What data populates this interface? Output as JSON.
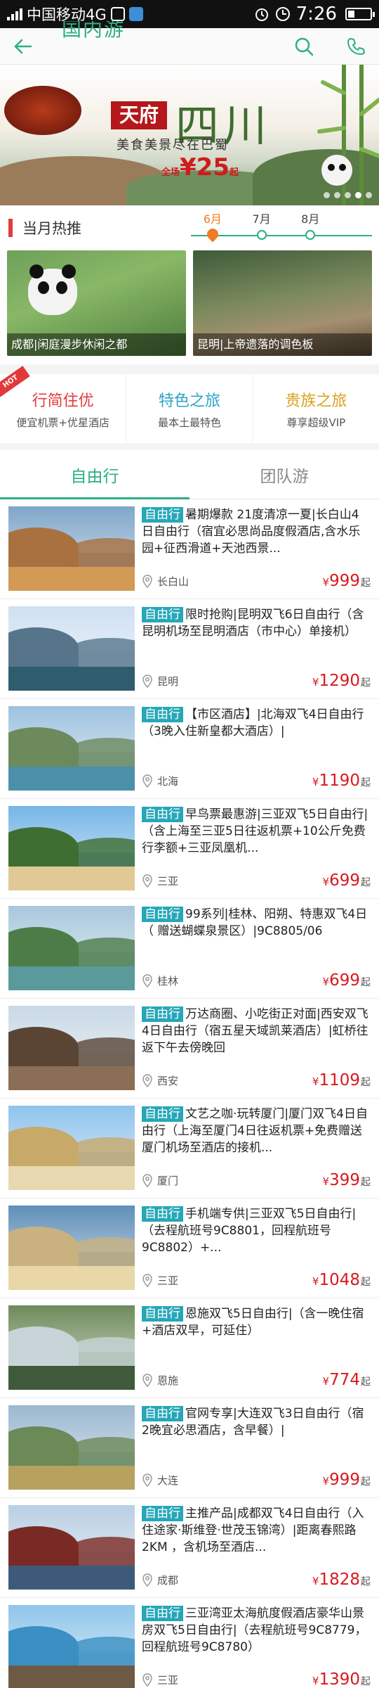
{
  "status_bar": {
    "carrier": "中国移动4G",
    "time": "7:26",
    "battery_level": 0.3
  },
  "header": {
    "title": "国内游",
    "back_icon": "arrow-left-icon",
    "search_icon": "search-icon",
    "phone_icon": "phone-icon"
  },
  "banner": {
    "tag": "天府",
    "title": "四川",
    "slogan": "美食美景尽在巴蜀",
    "price_prefix": "全场",
    "price": "¥25",
    "price_suffix": "起",
    "slide_count": 5,
    "active_slide": 3
  },
  "hot": {
    "label": "当月热推",
    "months": [
      {
        "label": "6月",
        "active": true
      },
      {
        "label": "7月",
        "active": false
      },
      {
        "label": "8月",
        "active": false
      }
    ],
    "cards": [
      {
        "caption": "成都|闲庭漫步休闲之都"
      },
      {
        "caption": "昆明|上帝遗落的调色板"
      }
    ]
  },
  "categories": [
    {
      "title": "行简住优",
      "subtitle": "便宜机票+优星酒店",
      "color": "#e23b3b",
      "hot_ribbon": "HOT"
    },
    {
      "title": "特色之旅",
      "subtitle": "最本土最特色",
      "color": "#2fa3c8"
    },
    {
      "title": "贵族之旅",
      "subtitle": "尊享超级VIP",
      "color": "#d8a21f"
    }
  ],
  "tabs": [
    {
      "label": "自由行",
      "active": true
    },
    {
      "label": "团队游",
      "active": false
    }
  ],
  "badge_label": "自由行",
  "price_suffix": "起",
  "currency": "¥",
  "items": [
    {
      "title": "暑期爆款 21度清凉一夏|长白山4日自由行（宿宜必思尚品度假酒店,含水乐园+征西滑道+天池西景...",
      "location": "长白山",
      "price": "999"
    },
    {
      "title": "限时抢购|昆明双飞6日自由行（含昆明机场至昆明酒店（市中心）单接机）",
      "location": "昆明",
      "price": "1290"
    },
    {
      "title": "【市区酒店】|北海双飞4日自由行（3晚入住新皇都大酒店）|",
      "location": "北海",
      "price": "1190"
    },
    {
      "title": "早鸟票最惠游|三亚双飞5日自由行|（含上海至三亚5日往返机票+10公斤免费行李额+三亚凤凰机...",
      "location": "三亚",
      "price": "699"
    },
    {
      "title": "99系列|桂林、阳朔、特惠双飞4日（ 赠送蝴蝶泉景区）|9C8805/06",
      "location": "桂林",
      "price": "699"
    },
    {
      "title": "万达商圈、小吃街正对面|西安双飞4日自由行（宿五星天域凯莱酒店）|虹桥往返下午去傍晚回",
      "location": "西安",
      "price": "1109"
    },
    {
      "title": "文艺之咖·玩转厦门|厦门双飞4日自由行（上海至厦门4日往返机票+免费赠送厦门机场至酒店的接机...",
      "location": "厦门",
      "price": "399"
    },
    {
      "title": "手机端专供|三亚双飞5日自由行|（去程航班号9C8801，回程航班号9C8802）+...",
      "location": "三亚",
      "price": "1048"
    },
    {
      "title": "恩施双飞5日自由行|（含一晚住宿+酒店双早，可延住）",
      "location": "恩施",
      "price": "774"
    },
    {
      "title": "官网专享|大连双飞3日自由行（宿2晚宜必思酒店，含早餐）|",
      "location": "大连",
      "price": "999"
    },
    {
      "title": "主推产品|成都双飞4日自由行（入住途家·斯维登·世茂玉锦湾）|距离春熙路2KM ，含机场至酒店...",
      "location": "成都",
      "price": "1828"
    },
    {
      "title": "三亚湾亚太海航度假酒店豪华山景房双飞5日自由行|（去程航班号9C8779，回程航班号9C8780）",
      "location": "三亚",
      "price": "1390"
    }
  ]
}
